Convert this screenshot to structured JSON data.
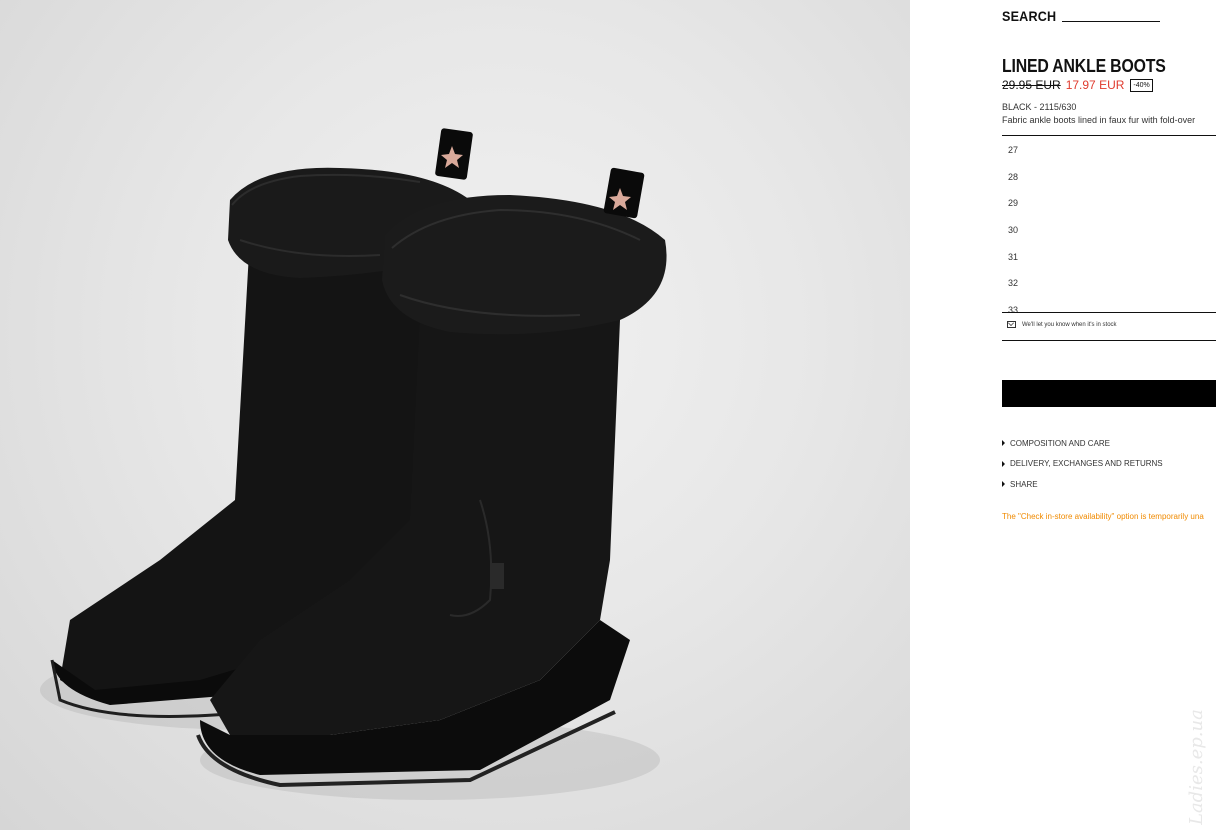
{
  "header": {
    "search_label": "SEARCH"
  },
  "product": {
    "title": "LINED ANKLE BOOTS",
    "price_original": "29.95 EUR",
    "price_sale": "17.97 EUR",
    "discount": "-40%",
    "color_ref": "BLACK - 2115/630",
    "description": "Fabric ankle boots lined in faux fur with fold-over"
  },
  "sizes": [
    "27",
    "28",
    "29",
    "30",
    "31",
    "32",
    "33"
  ],
  "notify": {
    "icon": "mail-icon",
    "text": "We'll let you know when it's in stock"
  },
  "accordion": [
    {
      "label": "COMPOSITION AND CARE",
      "icon": "caret-right-icon"
    },
    {
      "label": "DELIVERY, EXCHANGES AND RETURNS",
      "icon": "caret-right-icon"
    },
    {
      "label": "SHARE",
      "icon": "caret-right-icon"
    }
  ],
  "store_note": "The \"Check in-store availability\" option is temporarily una",
  "watermark": "Ladies.ep.ua",
  "colors": {
    "sale_price": "#e03b2e",
    "notice": "#f08a00",
    "primary_button": "#000000"
  }
}
